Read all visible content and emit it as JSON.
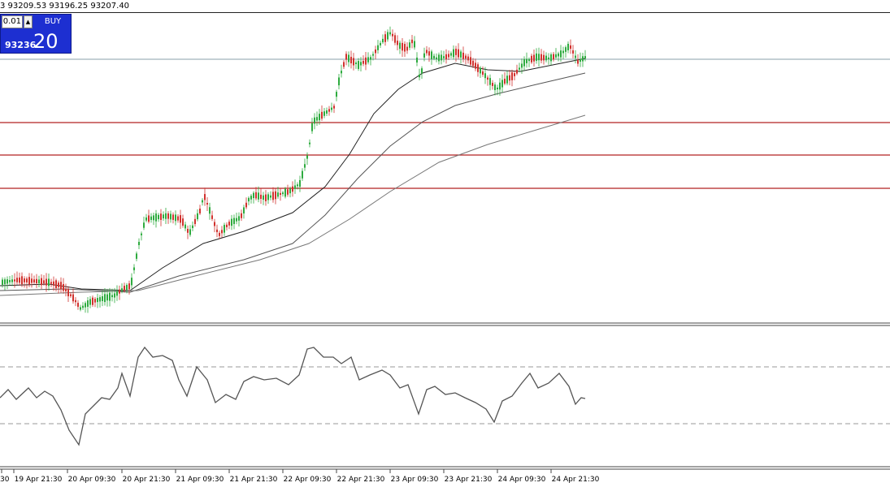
{
  "header": {
    "ohlc_text": "3 93209.53 93196.25 93207.40"
  },
  "trade_panel": {
    "lot_value": "0.01",
    "spinner_glyph": "▲",
    "buy_label": "BUY",
    "buy_price_main": "93236",
    "buy_price_big": "20",
    "panel_color": "#1d2fd1"
  },
  "time_axis": {
    "labels": [
      "30",
      "19 Apr 21:30",
      "20 Apr 09:30",
      "20 Apr 21:30",
      "21 Apr 09:30",
      "21 Apr 21:30",
      "22 Apr 09:30",
      "22 Apr 21:30",
      "23 Apr 09:30",
      "23 Apr 21:30",
      "24 Apr 09:30",
      "24 Apr 21:30"
    ]
  },
  "colors": {
    "bull_candle": "#2eab3f",
    "bear_candle": "#d1322e",
    "level_lines": "#b22222",
    "ma_lines": "#333333",
    "oscillator": "#555555",
    "bid_line": "#8aa0a8"
  },
  "oscillator": {
    "upper_level_dashed": true,
    "lower_level_dashed": true
  }
}
